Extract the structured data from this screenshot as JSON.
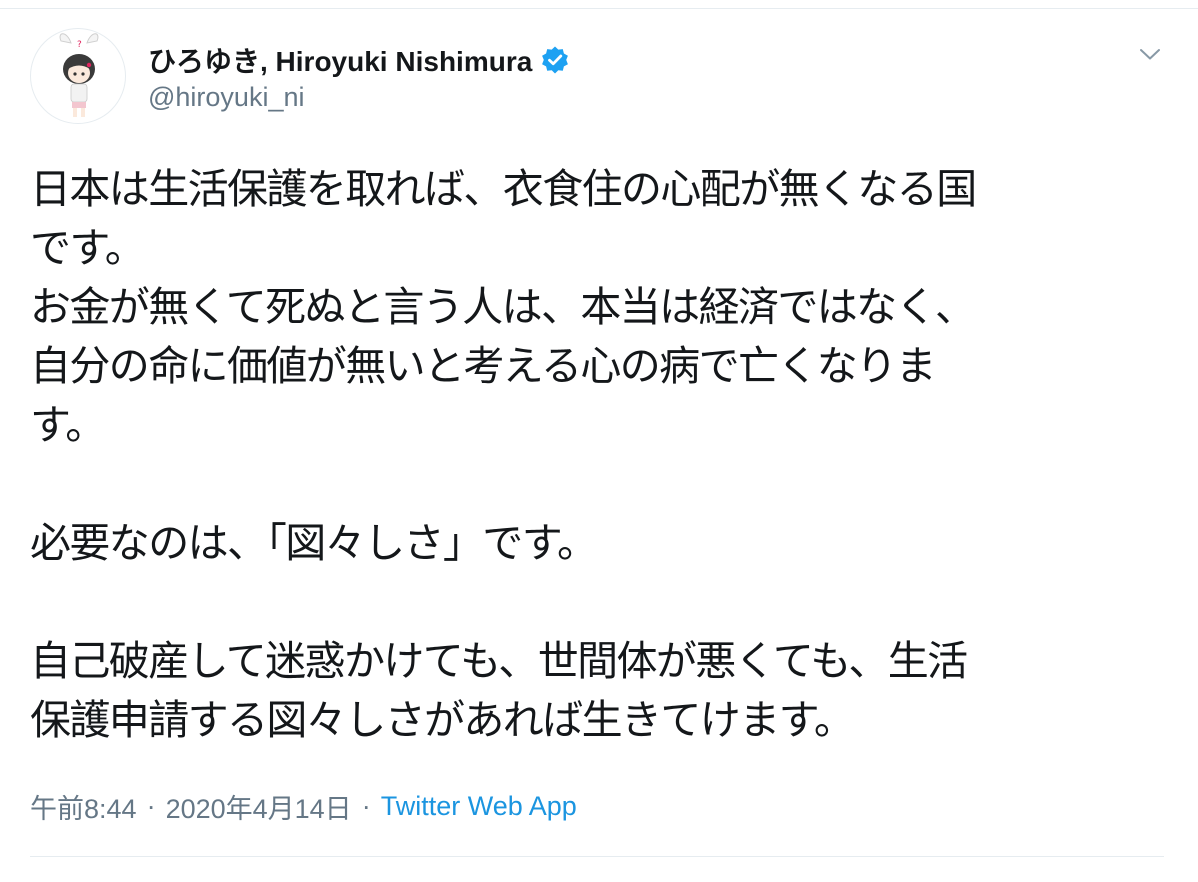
{
  "tweet": {
    "author": {
      "display_name": "ひろゆき, Hiroyuki Nishimura",
      "handle": "@hiroyuki_ni",
      "verified": true,
      "avatar_icon": "avatar-character-illustration"
    },
    "menu_icon": "chevron-down-icon",
    "text_lines": [
      "日本は生活保護を取れば、衣食住の心配が無くなる国",
      "です。",
      "お金が無くて死ぬと言う人は、本当は経済ではなく、",
      "自分の命に価値が無いと考える心の病で亡くなりま",
      "す。",
      "",
      "必要なのは、「図々しさ」です。",
      "",
      "自己破産して迷惑かけても、世間体が悪くても、生活",
      "保護申請する図々しさがあれば生きてけます。"
    ],
    "meta": {
      "time": "午前8:44",
      "separator": "·",
      "date": "2020年4月14日",
      "source": "Twitter Web App"
    }
  },
  "colors": {
    "text": "#14171a",
    "secondary": "#657786",
    "link": "#1b95e0",
    "verified": "#1da1f2",
    "divider": "#e6ecf0"
  }
}
